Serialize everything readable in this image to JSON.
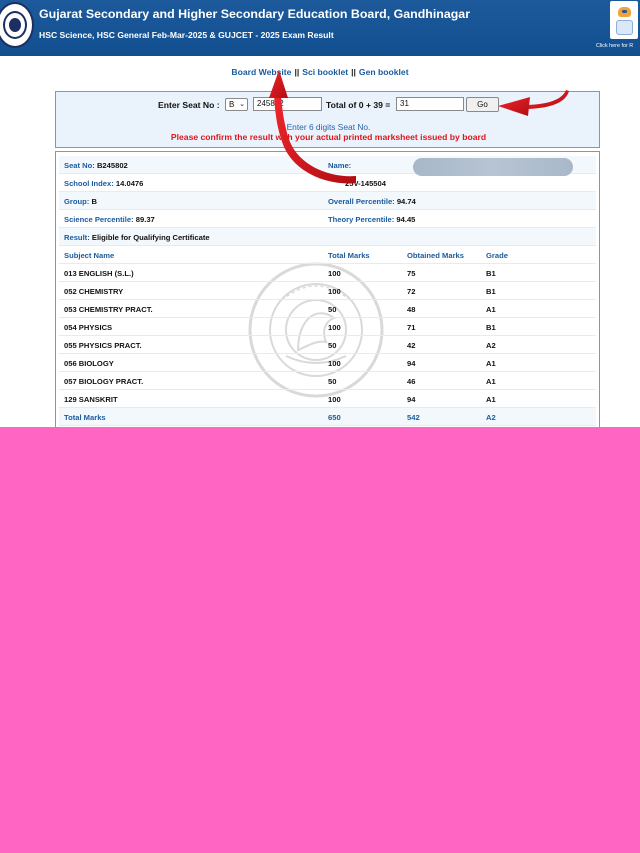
{
  "header": {
    "title": "Gujarat Secondary and Higher Secondary Education Board, Gandhinagar",
    "subtitle": "HSC Science, HSC General Feb-Mar-2025 & GUJCET - 2025 Exam Result",
    "bot_caption": "Click here for R"
  },
  "nav": {
    "links": [
      "Board Website",
      "Sci booklet",
      "Gen booklet"
    ],
    "separator": "||"
  },
  "search": {
    "label": "Enter Seat No :",
    "series_value": "B",
    "seat_value": "245802",
    "captcha_text": "Total of 0 + 39 =",
    "captcha_answer": "31",
    "go_label": "Go",
    "hint": "Enter 6 digits Seat No.",
    "warning": "Please confirm the result with your actual printed marksheet issued by board"
  },
  "result": {
    "seat_label": "Seat No:",
    "seat_value": "B245802",
    "name_label": "Name:",
    "name_value": "",
    "school_label": "School Index:",
    "school_value": "14.0476",
    "spu_value": "25V-145504",
    "group_label": "Group:",
    "group_value": "B",
    "overall_label": "Overall Percentile:",
    "overall_value": "94.74",
    "science_label": "Science Percentile:",
    "science_value": "89.37",
    "theory_label": "Theory Percentile:",
    "theory_value": "94.45",
    "result_label": "Result:",
    "result_value": "Eligible for Qualifying Certificate"
  },
  "table": {
    "headers": [
      "Subject Name",
      "Total Marks",
      "Obtained Marks",
      "Grade"
    ],
    "rows": [
      [
        "013 ENGLISH (S.L.)",
        "100",
        "75",
        "B1"
      ],
      [
        "052 CHEMISTRY",
        "100",
        "72",
        "B1"
      ],
      [
        "053 CHEMISTRY PRACT.",
        "50",
        "48",
        "A1"
      ],
      [
        "054 PHYSICS",
        "100",
        "71",
        "B1"
      ],
      [
        "055 PHYSICS PRACT.",
        "50",
        "42",
        "A2"
      ],
      [
        "056 BIOLOGY",
        "100",
        "94",
        "A1"
      ],
      [
        "057 BIOLOGY PRACT.",
        "50",
        "46",
        "A1"
      ],
      [
        "129 SANSKRIT",
        "100",
        "94",
        "A1"
      ]
    ],
    "total": [
      "Total Marks",
      "650",
      "542",
      "A2"
    ]
  },
  "colors": {
    "header_blue": "#1d5a9c",
    "link_blue": "#1a5a9e",
    "warning_red": "#e0151b",
    "arrow_red": "#d0141a",
    "overlay_pink": "#ff66c4"
  }
}
